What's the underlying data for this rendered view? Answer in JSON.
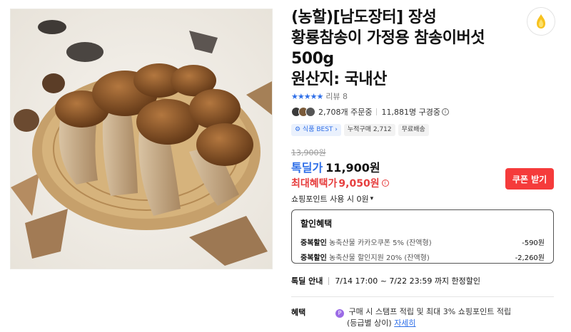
{
  "product": {
    "title_lines": [
      "(농할)[남도장터] 장성",
      "황룡참송이 가정용 참송이버섯",
      "500g"
    ],
    "origin": "원산지: 국내산"
  },
  "rating": {
    "stars": "★★★★★",
    "review_label": "리뷰 8"
  },
  "stats": {
    "orders": "2,708개 주문중",
    "watching": "11,881명 구경중"
  },
  "badges": {
    "best": "⚙ 식품 BEST ›",
    "cumulative": "누적구매 2,712",
    "shipping": "무료배송"
  },
  "price": {
    "original": "13,900원",
    "deal_label": "톡딜가",
    "deal_price": "11,900원",
    "max_label": "최대혜택가",
    "max_price": "9,050원"
  },
  "coupon_button": "쿠폰 받기",
  "points_label": "쇼핑포인트 사용 시 0원",
  "discount": {
    "title": "할인혜택",
    "lines": [
      {
        "label": "중복할인",
        "desc": "농축산물 카카오쿠폰 5% (잔액형)",
        "amount": "-590원"
      },
      {
        "label": "중복할인",
        "desc": "농축산물 할인지원 20% (잔액형)",
        "amount": "-2,260원"
      }
    ]
  },
  "limited": {
    "label": "톡딜 안내",
    "text": "7/14 17:00 ~ 7/22 23:59 까지 한정할인"
  },
  "benefit": {
    "label": "혜택",
    "text": "구매 시 스탬프 적립 및 최대 3% 쇼핑포인트 적립",
    "sub": "(등급별 상이)",
    "link": "자세히"
  },
  "colors": {
    "accent_blue": "#2f6fe8",
    "accent_red": "#e63e3e",
    "coupon_bg": "#f53b3b"
  },
  "icons": {
    "favorite": "flame-icon",
    "info": "info-icon",
    "chevron": "chevron-down-icon"
  }
}
